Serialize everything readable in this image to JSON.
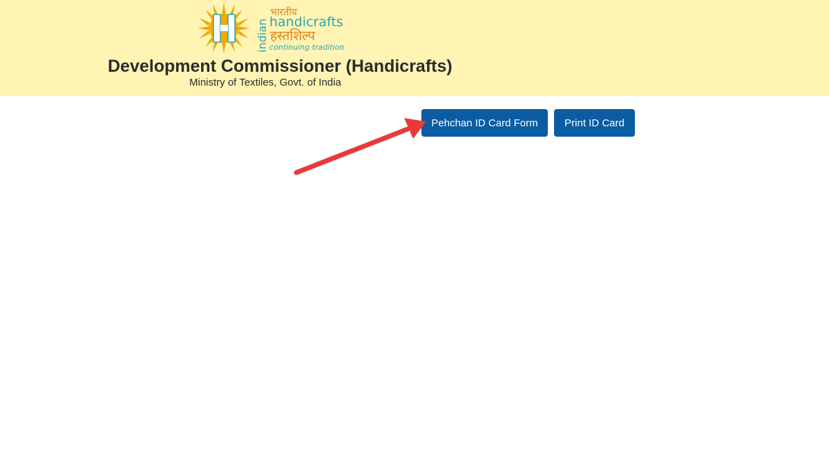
{
  "header": {
    "logo": {
      "word_hindi_small": "भारतीय",
      "word_vertical": "indian",
      "word_main": "handicrafts",
      "word_hindi": "हस्तशिल्प",
      "tagline": "continuing tradition",
      "letter": "H"
    },
    "title": "Development Commissioner (Handicrafts)",
    "subtitle": "Ministry of Textiles, Govt. of India"
  },
  "actions": {
    "form_button_label": "Pehchan ID Card Form",
    "print_button_label": "Print ID Card"
  },
  "colors": {
    "header_bg": "#fff4b3",
    "button_bg": "#0b5ca3",
    "sun": "#f2a900",
    "teal": "#2aa6b5",
    "annotation_arrow": "#e83a3a"
  }
}
